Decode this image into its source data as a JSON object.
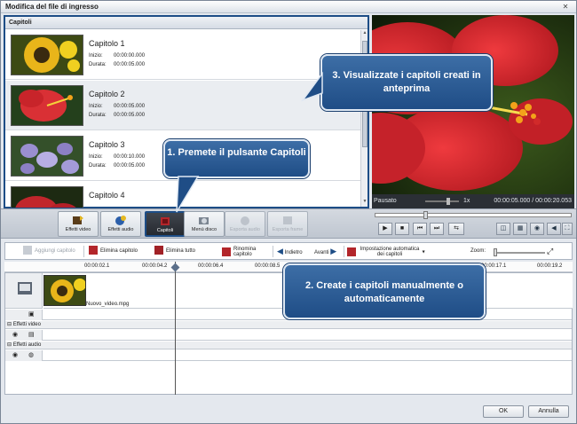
{
  "window": {
    "title": "Modifica del file di ingresso",
    "close_glyph": "✕"
  },
  "chapters": {
    "header": "Capitoli",
    "inizio_label": "Inizio:",
    "durata_label": "Durata:",
    "items": [
      {
        "name": "Capitolo 1",
        "inizio": "00:00:00.000",
        "durata": "00:00:05.000"
      },
      {
        "name": "Capitolo 2",
        "inizio": "00:00:05.000",
        "durata": "00:00:05.000"
      },
      {
        "name": "Capitolo 3",
        "inizio": "00:00:10.000",
        "durata": "00:00:05.000"
      },
      {
        "name": "Capitolo 4"
      }
    ]
  },
  "player": {
    "status": "Pausato",
    "speed": "1x",
    "time": "00:00:05.000 / 00:00:20.053",
    "seek_position": 0.25
  },
  "toolbar": {
    "effetti_video": "Effetti video",
    "effetti_audio": "Effetti audio",
    "capitoli": "Capitoli",
    "menu_disco": "Menù disco",
    "esporta_audio": "Esporta audio",
    "esporta_frame": "Esporta frame"
  },
  "timeline_toolbar": {
    "aggiungi": "Aggiungi capitolo",
    "elimina": "Elimina capitolo",
    "elimina_tutto": "Elimina tutto",
    "rinomina": "Rinomina capitolo",
    "indietro": "Indietro",
    "avanti": "Avanti",
    "impostazione": "Impostazione automatica dei capitoli",
    "zoom": "Zoom:"
  },
  "ruler": [
    "00:00:02.1",
    "00:00:04.2",
    "00:00:06.4",
    "00:00:08.5",
    "00:00:17.1",
    "00:00:19.2"
  ],
  "tracks": {
    "clip_name": "Nuovo_video.mpg",
    "effetti_video": "Effetti video",
    "effetti_audio": "Effetti audio"
  },
  "buttons": {
    "ok": "OK",
    "annulla": "Annulla"
  },
  "callouts": {
    "c1": "1. Premete il pulsante Capitoli",
    "c2": "2. Create i capitoli manualmente o automaticamente",
    "c3": "3. Visualizzate i capitoli creati in anteprima"
  },
  "colors": {
    "accent": "#1d4d86",
    "callout": "#2c5d96",
    "preview_flower": "#d42a2e"
  },
  "icons": [
    "close-icon",
    "effetti-video-icon",
    "effetti-audio-icon",
    "capitoli-icon",
    "disc-icon",
    "export-audio-icon",
    "export-frame-icon",
    "play-icon",
    "stop-icon",
    "prev-icon",
    "next-icon",
    "volume-icon",
    "camera-icon",
    "fullscreen-icon"
  ]
}
